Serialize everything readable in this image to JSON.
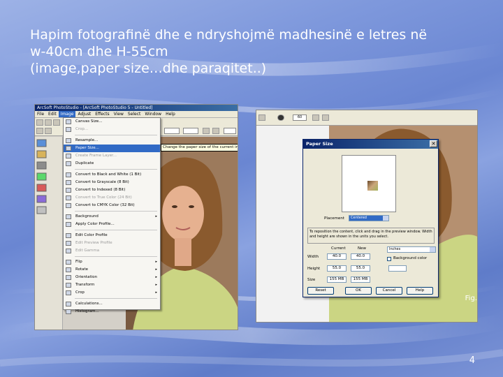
{
  "slide": {
    "title_line1": "Hapim fotografinë dhe e ndryshojmë madhesinë e letres në",
    "title_line2": "w-40cm dhe H-55cm",
    "title_line3": "(image,paper size…dhe paraqitet..)",
    "page_number": "4"
  },
  "left_screenshot": {
    "window_title": "ArcSoft PhotoStudio - [ArcSoft PhotoStudio 5 - Untitled]",
    "menubar": [
      "File",
      "Edit",
      "Image",
      "Adjust",
      "Effects",
      "View",
      "Select",
      "Window",
      "Help"
    ],
    "active_menu": "Image",
    "menu_items": [
      {
        "label": "Canvas Size...",
        "disabled": false
      },
      {
        "label": "Crop...",
        "disabled": true
      },
      {
        "sep": true
      },
      {
        "label": "Resample...",
        "disabled": false
      },
      {
        "label": "Paper Size...",
        "disabled": false,
        "highlight": true
      },
      {
        "label": "Create Frame Layer...",
        "disabled": true
      },
      {
        "label": "Duplicate",
        "disabled": false
      },
      {
        "sep": true
      },
      {
        "label": "Convert to Black and White (1 Bit)",
        "disabled": false
      },
      {
        "label": "Convert to Grayscale (8 Bit)",
        "disabled": false
      },
      {
        "label": "Convert to Indexed (8 Bit)",
        "disabled": false
      },
      {
        "label": "Convert to True Color (24 Bit)",
        "disabled": true
      },
      {
        "label": "Convert to CMYK Color (32 Bit)",
        "disabled": false
      },
      {
        "sep": true
      },
      {
        "label": "Background",
        "disabled": false,
        "submenu": true
      },
      {
        "label": "Apply Color Profile...",
        "disabled": false
      },
      {
        "sep": true
      },
      {
        "label": "Edit Color Profile",
        "disabled": false
      },
      {
        "label": "Edit Preview Profile",
        "disabled": true
      },
      {
        "label": "Edit Gamma",
        "disabled": true
      },
      {
        "sep": true
      },
      {
        "label": "Flip",
        "disabled": false,
        "submenu": true
      },
      {
        "label": "Rotate",
        "disabled": false,
        "submenu": true
      },
      {
        "label": "Orientation",
        "disabled": false,
        "submenu": true
      },
      {
        "label": "Transform",
        "disabled": false,
        "submenu": true
      },
      {
        "label": "Crop",
        "disabled": false,
        "submenu": true
      },
      {
        "sep": true
      },
      {
        "label": "Calculations...",
        "disabled": false
      },
      {
        "label": "Histogram...",
        "disabled": false
      }
    ],
    "tooltip": "Change the paper size of the current image"
  },
  "right_screenshot": {
    "size_value": "60",
    "fig_label": "Fig.",
    "dialog": {
      "title": "Paper Size",
      "close_glyph": "✕",
      "placement_label": "Placement",
      "placement_value": "Centered",
      "instruction": "To reposition the content, click and drag in the preview window. Width and height are shown in the units you select.",
      "current_label": "Current",
      "new_label": "New",
      "width_label": "Width",
      "height_label": "Height",
      "width_current": "40.0",
      "width_new": "40.0",
      "height_current": "55.0",
      "height_new": "55.0",
      "unit_value": "Inches",
      "background_label": "Background color",
      "size_label": "Size",
      "size_current": "155 MB",
      "size_new": "155 MB",
      "reset_label": "Reset",
      "ok_label": "OK",
      "cancel_label": "Cancel",
      "help_label": "Help"
    }
  },
  "colors": {
    "menu_highlight": "#316ac5",
    "titlebar": "#0a246a",
    "slide_bg": "#7b93d6"
  }
}
